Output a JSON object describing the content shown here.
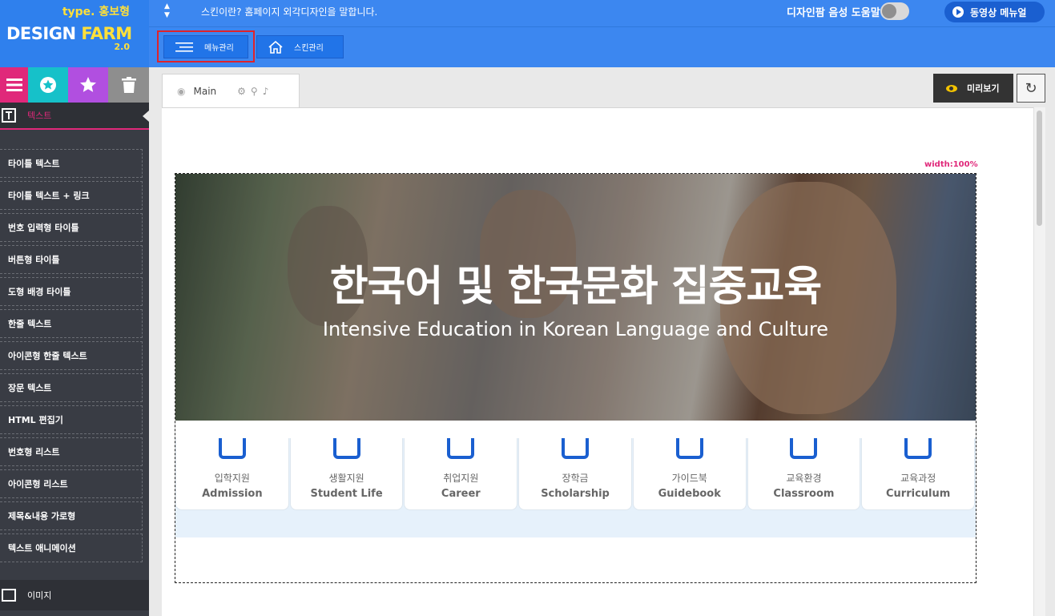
{
  "header": {
    "type_label": "type. 홍보형",
    "brand_design": "DESIGN",
    "brand_farm": "FARM",
    "version": "2.0",
    "description": "스킨이란? 홈페이지 외각디자인을 말합니다.",
    "voice_help_label": "디자인팜 음성 도움말",
    "voice_help_on": false,
    "video_manual_label": "동영상 메뉴얼"
  },
  "tabs": {
    "menu_label": "메뉴관리",
    "skin_label": "스킨관리",
    "active": "메뉴관리"
  },
  "sidebar": {
    "category_label": "텍스트",
    "items": [
      {
        "label": "타이틀 텍스트"
      },
      {
        "label": "타이틀 텍스트 + 링크"
      },
      {
        "label": "번호 입력형 타이틀"
      },
      {
        "label": "버튼형 타이틀"
      },
      {
        "label": "도형 배경 타이틀"
      },
      {
        "label": "한줄 텍스트"
      },
      {
        "label": "아이콘형 한줄 텍스트"
      },
      {
        "label": "장문 텍스트"
      },
      {
        "label": "HTML 편집기"
      },
      {
        "label": "번호형 리스트"
      },
      {
        "label": "아이콘형 리스트"
      },
      {
        "label": "제목&내용 가로형"
      },
      {
        "label": "텍스트 애니메이션"
      }
    ],
    "image_category_label": "이미지"
  },
  "workspace": {
    "page_tab_label": "Main",
    "preview_label": "미리보기",
    "width_label": "width:100%"
  },
  "hero": {
    "title": "한국어 및 한국문화 집중교육",
    "subtitle": "Intensive Education in Korean Language and Culture"
  },
  "cards": [
    {
      "ko": "입학지원",
      "en": "Admission"
    },
    {
      "ko": "생활지원",
      "en": "Student Life"
    },
    {
      "ko": "취업지원",
      "en": "Career"
    },
    {
      "ko": "장학금",
      "en": "Scholarship"
    },
    {
      "ko": "가이드북",
      "en": "Guidebook"
    },
    {
      "ko": "교육환경",
      "en": "Classroom"
    },
    {
      "ko": "교육과정",
      "en": "Curriculum"
    }
  ],
  "colors": {
    "header_blue": "#3c87f0",
    "accent_pink": "#e0287a",
    "logo_yellow": "#ffe03a",
    "highlight_red": "#e0232a",
    "icon_blue": "#1a5fd0"
  }
}
